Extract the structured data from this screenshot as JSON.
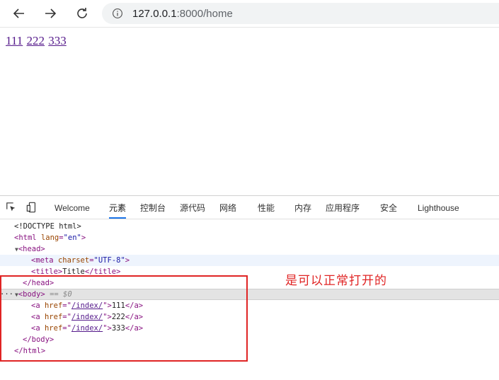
{
  "browser": {
    "back_icon": "arrow-left-icon",
    "forward_icon": "arrow-right-icon",
    "reload_icon": "reload-icon",
    "info_icon": "info-icon",
    "url_host": "127.0.0.1",
    "url_path": ":8000/home"
  },
  "page": {
    "links": [
      "111",
      "222",
      "333"
    ]
  },
  "devtools": {
    "tabs": [
      {
        "label": "Welcome"
      },
      {
        "label": "元素"
      },
      {
        "label": "控制台"
      },
      {
        "label": "源代码"
      },
      {
        "label": "网络"
      },
      {
        "label": "性能"
      },
      {
        "label": "内存"
      },
      {
        "label": "应用程序"
      },
      {
        "label": "安全"
      },
      {
        "label": "Lighthouse"
      }
    ],
    "active_tab": "元素",
    "dom": {
      "doctype": "<!DOCTYPE html>",
      "html_open": "<html",
      "html_lang_attr": "lang",
      "html_lang_val": "\"en\"",
      "head_open": "<head>",
      "meta_open": "<meta",
      "meta_attr": "charset",
      "meta_val": "\"UTF-8\"",
      "title_open": "<title>",
      "title_text": "Title",
      "title_close": "</title>",
      "head_close": "</head>",
      "body_open": "<body>",
      "body_marker": "== $0",
      "anchors": [
        {
          "href": "/index/",
          "text": "111"
        },
        {
          "href": "/index/",
          "text": "222"
        },
        {
          "href": "/index/",
          "text": "333"
        }
      ],
      "a_open": "<a",
      "href_attr": "href",
      "a_close": "</a>",
      "body_close": "</body>",
      "html_close": "</html>"
    }
  },
  "annotation": {
    "text": "是可以正常打开的",
    "color": "#e02424"
  }
}
